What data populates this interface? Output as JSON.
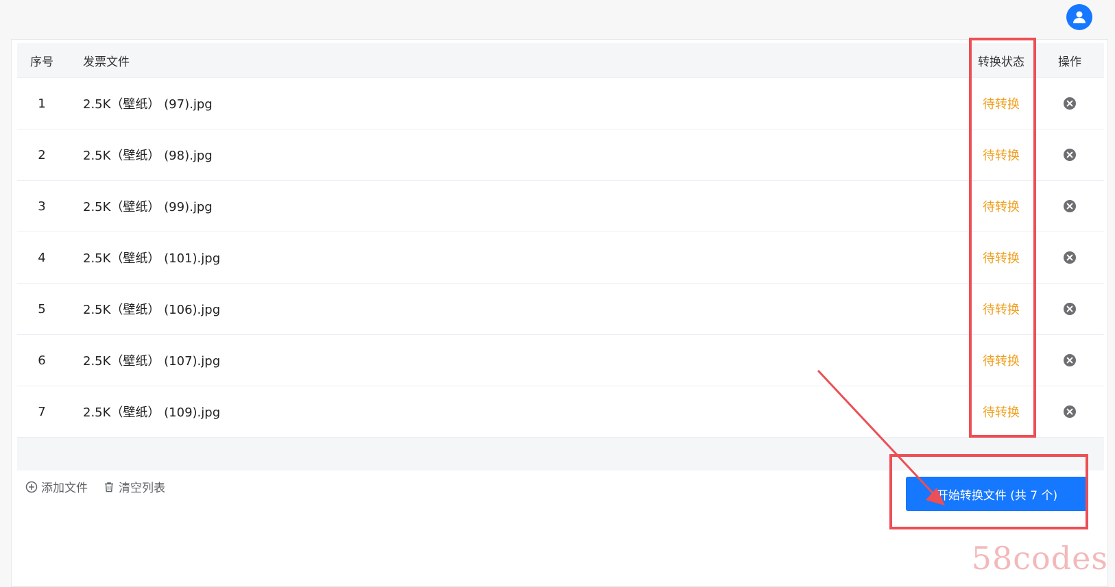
{
  "table": {
    "headers": {
      "index": "序号",
      "file": "发票文件",
      "status": "转换状态",
      "action": "操作"
    },
    "rows": [
      {
        "index": "1",
        "file": "2.5K（壁纸） (97).jpg",
        "status": "待转换"
      },
      {
        "index": "2",
        "file": "2.5K（壁纸） (98).jpg",
        "status": "待转换"
      },
      {
        "index": "3",
        "file": "2.5K（壁纸） (99).jpg",
        "status": "待转换"
      },
      {
        "index": "4",
        "file": "2.5K（壁纸） (101).jpg",
        "status": "待转换"
      },
      {
        "index": "5",
        "file": "2.5K（壁纸） (106).jpg",
        "status": "待转换"
      },
      {
        "index": "6",
        "file": "2.5K（壁纸） (107).jpg",
        "status": "待转换"
      },
      {
        "index": "7",
        "file": "2.5K（壁纸） (109).jpg",
        "status": "待转换"
      }
    ]
  },
  "footer": {
    "add_label": "添加文件",
    "clear_label": "清空列表",
    "start_label": "开始转换文件 (共 7 个)"
  },
  "watermark": "58codes",
  "icons": {
    "avatar": "user-avatar-icon",
    "delete": "close-circle-icon",
    "add": "plus-circle-icon",
    "clear": "trash-icon"
  },
  "colors": {
    "primary": "#1677ff",
    "status_pending": "#f0a020",
    "annotation": "#ec4f55"
  }
}
